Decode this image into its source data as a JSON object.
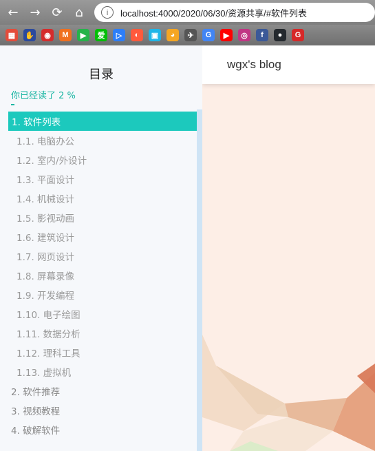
{
  "browser": {
    "url": "localhost:4000/2020/06/30/资源共享/#软件列表",
    "info_glyph": "i",
    "back_glyph": "←",
    "forward_glyph": "→",
    "reload_glyph": "⟳",
    "home_glyph": "⌂"
  },
  "bookmarks": [
    {
      "icon": "apps-grid-icon",
      "glyph": "▦",
      "color": "#e34c3b"
    },
    {
      "icon": "hand-icon",
      "glyph": "✋",
      "color": "#2b4a9e"
    },
    {
      "icon": "weibo-icon",
      "glyph": "◉",
      "color": "#d52c2c"
    },
    {
      "icon": "m-app-icon",
      "glyph": "M",
      "color": "#f07020"
    },
    {
      "icon": "play-icon",
      "glyph": "▶",
      "color": "#25b34a"
    },
    {
      "icon": "iqiyi-icon",
      "glyph": "爱",
      "color": "#00be06"
    },
    {
      "icon": "youku-icon",
      "glyph": "▷",
      "color": "#2c7ef8"
    },
    {
      "icon": "mgtv-icon",
      "glyph": "◐",
      "color": "#ff5a3c"
    },
    {
      "icon": "bilibili-icon",
      "glyph": "▣",
      "color": "#1fb6e8"
    },
    {
      "icon": "acfun-icon",
      "glyph": "◕",
      "color": "#f5a623"
    },
    {
      "icon": "bird-icon",
      "glyph": "✈",
      "color": "#555555"
    },
    {
      "icon": "google-icon",
      "glyph": "G",
      "color": "#4285f4"
    },
    {
      "icon": "youtube-icon",
      "glyph": "▶",
      "color": "#ff0000"
    },
    {
      "icon": "instagram-icon",
      "glyph": "◎",
      "color": "#c13584"
    },
    {
      "icon": "facebook-icon",
      "glyph": "f",
      "color": "#3b5998"
    },
    {
      "icon": "github-icon",
      "glyph": "●",
      "color": "#24292e"
    },
    {
      "icon": "g-red-icon",
      "glyph": "G",
      "color": "#d62828"
    }
  ],
  "sidebar": {
    "title": "目录",
    "progress_text": "你已经读了  2  %",
    "accent": "#1cc9bd",
    "items": [
      {
        "label": "1. 软件列表",
        "level": 1,
        "active": true
      },
      {
        "label": "1.1. 电脑办公",
        "level": 2
      },
      {
        "label": "1.2. 室内/外设计",
        "level": 2
      },
      {
        "label": "1.3. 平面设计",
        "level": 2
      },
      {
        "label": "1.4. 机械设计",
        "level": 2
      },
      {
        "label": "1.5. 影视动画",
        "level": 2
      },
      {
        "label": "1.6. 建筑设计",
        "level": 2
      },
      {
        "label": "1.7. 网页设计",
        "level": 2
      },
      {
        "label": "1.8. 屏幕录像",
        "level": 2
      },
      {
        "label": "1.9. 开发编程",
        "level": 2
      },
      {
        "label": "1.10. 电子绘图",
        "level": 2
      },
      {
        "label": "1.11. 数据分析",
        "level": 2
      },
      {
        "label": "1.12. 理科工具",
        "level": 2
      },
      {
        "label": "1.13. 虚拟机",
        "level": 2
      },
      {
        "label": "2. 软件推荐",
        "level": 1
      },
      {
        "label": "3. 视频教程",
        "level": 1
      },
      {
        "label": "4. 破解软件",
        "level": 1
      }
    ]
  },
  "main": {
    "blog_title": "wgx's blog"
  }
}
